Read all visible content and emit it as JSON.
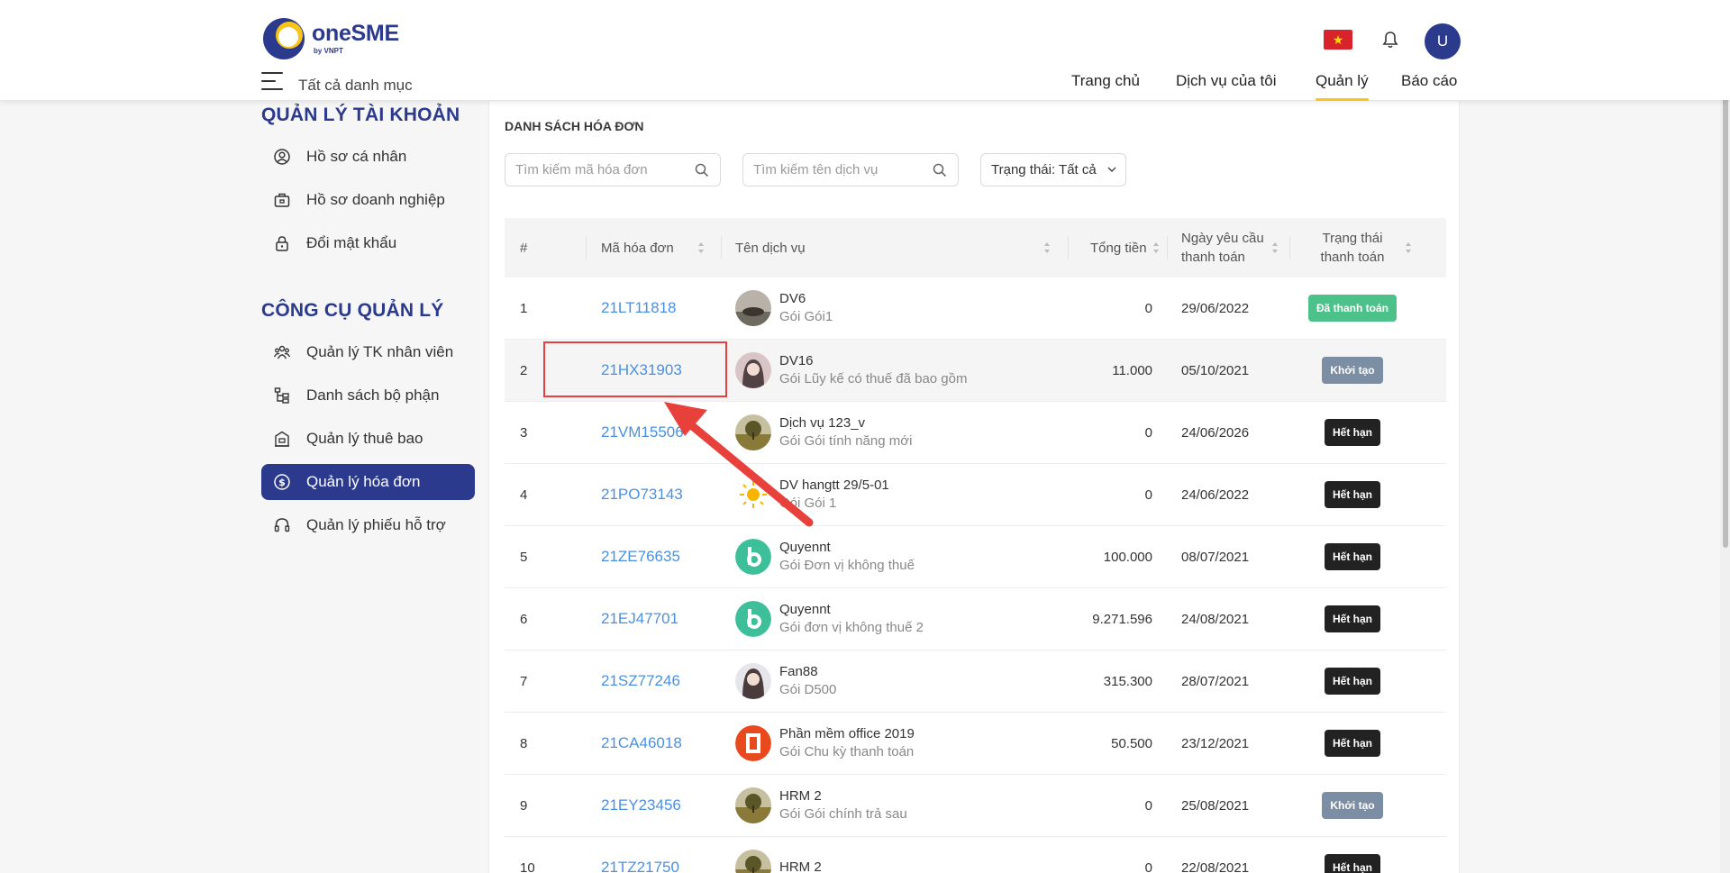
{
  "header": {
    "brand": "oneSME",
    "brand_sub": "by VNPT",
    "menu_label": "Tất cả danh mục",
    "avatar_initial": "U",
    "nav": [
      {
        "label": "Trang chủ"
      },
      {
        "label": "Dịch vụ của tôi"
      },
      {
        "label": "Quản lý",
        "active": true
      },
      {
        "label": "Báo cáo"
      }
    ]
  },
  "sidebar": {
    "account_title": "QUẢN LÝ TÀI KHOẢN",
    "account_items": [
      {
        "label": "Hồ sơ cá nhân",
        "icon": "user-circle-icon"
      },
      {
        "label": "Hồ sơ doanh nghiệp",
        "icon": "briefcase-icon"
      },
      {
        "label": "Đổi mật khẩu",
        "icon": "lock-icon"
      }
    ],
    "tools_title": "CÔNG CỤ QUẢN LÝ",
    "tools_items": [
      {
        "label": "Quản lý TK nhân viên",
        "icon": "users-icon"
      },
      {
        "label": "Danh sách bộ phận",
        "icon": "hierarchy-icon"
      },
      {
        "label": "Quản lý thuê bao",
        "icon": "building-icon"
      },
      {
        "label": "Quản lý hóa đơn",
        "icon": "dollar-circle-icon",
        "active": true
      },
      {
        "label": "Quản lý phiếu hỗ trợ",
        "icon": "headset-icon"
      }
    ]
  },
  "main": {
    "title": "DANH SÁCH HÓA ĐƠN",
    "search_code_placeholder": "Tìm kiếm mã hóa đơn",
    "search_service_placeholder": "Tìm kiếm tên dịch vụ",
    "status_filter": "Trạng thái: Tất cả",
    "columns": {
      "index": "#",
      "code": "Mã hóa đơn",
      "service": "Tên dịch vụ",
      "total": "Tổng tiền",
      "date_l1": "Ngày yêu cầu",
      "date_l2": "thanh toán",
      "status_l1": "Trạng thái",
      "status_l2": "thanh toán"
    },
    "rows": [
      {
        "idx": "1",
        "code": "21LT11818",
        "service": "DV6",
        "package": "Gói Gói1",
        "total": "0",
        "date": "29/06/2022",
        "status": "Đã thanh toán",
        "status_type": "paid",
        "thumb": "landscape"
      },
      {
        "idx": "2",
        "code": "21HX31903",
        "service": "DV16",
        "package": "Gói Lũy kế có thuế đã bao gồm",
        "total": "11.000",
        "date": "05/10/2021",
        "status": "Khởi tạo",
        "status_type": "init",
        "thumb": "portrait"
      },
      {
        "idx": "3",
        "code": "21VM15506",
        "service": "Dịch vụ 123_v",
        "package": "Gói Gói tính năng mới",
        "total": "0",
        "date": "24/06/2026",
        "status": "Hết hạn",
        "status_type": "expired",
        "thumb": "tree"
      },
      {
        "idx": "4",
        "code": "21PO73143",
        "service": "DV hangtt 29/5-01",
        "package": "Gói Gói 1",
        "total": "0",
        "date": "24/06/2022",
        "status": "Hết hạn",
        "status_type": "expired",
        "thumb": "sun"
      },
      {
        "idx": "5",
        "code": "21ZE76635",
        "service": "Quyennt",
        "package": "Gói Đơn vị không thuế",
        "total": "100.000",
        "date": "08/07/2021",
        "status": "Hết hạn",
        "status_type": "expired",
        "thumb": "b-logo"
      },
      {
        "idx": "6",
        "code": "21EJ47701",
        "service": "Quyennt",
        "package": "Gói đơn vị không thuế 2",
        "total": "9.271.596",
        "date": "24/08/2021",
        "status": "Hết hạn",
        "status_type": "expired",
        "thumb": "b-logo"
      },
      {
        "idx": "7",
        "code": "21SZ77246",
        "service": "Fan88",
        "package": "Gói D500",
        "total": "315.300",
        "date": "28/07/2021",
        "status": "Hết hạn",
        "status_type": "expired",
        "thumb": "portrait2"
      },
      {
        "idx": "8",
        "code": "21CA46018",
        "service": "Phần mềm office 2019",
        "package": "Gói Chu kỳ thanh toán",
        "total": "50.500",
        "date": "23/12/2021",
        "status": "Hết hạn",
        "status_type": "expired",
        "thumb": "office"
      },
      {
        "idx": "9",
        "code": "21EY23456",
        "service": "HRM 2",
        "package": "Gói Gói chính trả sau",
        "total": "0",
        "date": "25/08/2021",
        "status": "Khởi tạo",
        "status_type": "init",
        "thumb": "tree"
      },
      {
        "idx": "10",
        "code": "21TZ21750",
        "service": "HRM 2",
        "package": "",
        "total": "0",
        "date": "22/08/2021",
        "status": "Hết hạn",
        "status_type": "expired",
        "thumb": "tree"
      }
    ]
  },
  "colors": {
    "brand": "#2b3a8c",
    "accent": "#f5c518",
    "link": "#4a90e2",
    "paid": "#4cc18a",
    "init": "#7c8ea3",
    "expired": "#222222",
    "annotation": "#e8403a"
  }
}
